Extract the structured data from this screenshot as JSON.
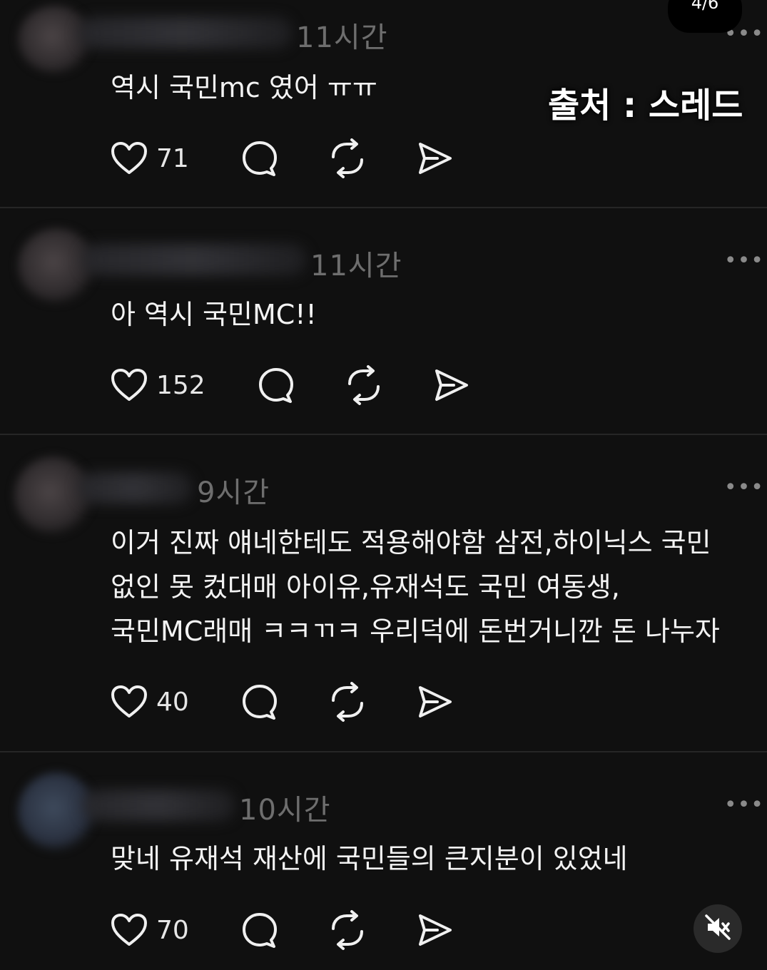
{
  "overlay": {
    "page_indicator": "4/6",
    "source_caption": "출처 : 스레드"
  },
  "more_label": "•••",
  "posts": [
    {
      "time": "11시간",
      "text_lines": [
        "역시 국민mc 였어 ㅠㅠ"
      ],
      "likes": "71"
    },
    {
      "time": "11시간",
      "text_lines": [
        "아 역시 국민MC!!"
      ],
      "likes": "152"
    },
    {
      "time": "9시간",
      "text_lines": [
        "이거 진짜 얘네한테도 적용해야함 삼전,하이닉스 국민",
        "없인 못 컸대매 아이유,유재석도 국민 여동생,",
        "국민MC래매 ㅋㅋㄲㅋ 우리덕에 돈번거니깐 돈 나누자"
      ],
      "likes": "40"
    },
    {
      "time": "10시간",
      "text_lines": [
        "맞네  유재석 재산에 국민들의 큰지분이 있었네"
      ],
      "likes": "70"
    }
  ],
  "icons": {
    "like": "heart-icon",
    "reply": "comment-bubble-icon",
    "repost": "repost-icon",
    "share": "send-icon",
    "mute": "speaker-muted-icon"
  }
}
